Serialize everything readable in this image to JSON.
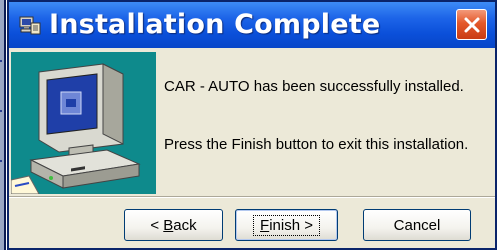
{
  "window": {
    "title": "Installation Complete",
    "close_symbol": "✕",
    "app_icon": "setup-app-icon"
  },
  "content": {
    "message_installed": "CAR - AUTO has been successfully installed.",
    "message_finish": "Press the Finish button to exit this installation.",
    "side_image": "computer-illustration"
  },
  "buttons": {
    "back": {
      "prefix": "< ",
      "accel": "B",
      "rest": "ack"
    },
    "finish": {
      "accel": "F",
      "rest": "inish >"
    },
    "cancel": "Cancel"
  },
  "colors": {
    "title_bar": "#0a4fd9",
    "dialog_bg": "#ece9d8",
    "side_panel": "#0e8a8c",
    "close_button": "#e4582a"
  }
}
